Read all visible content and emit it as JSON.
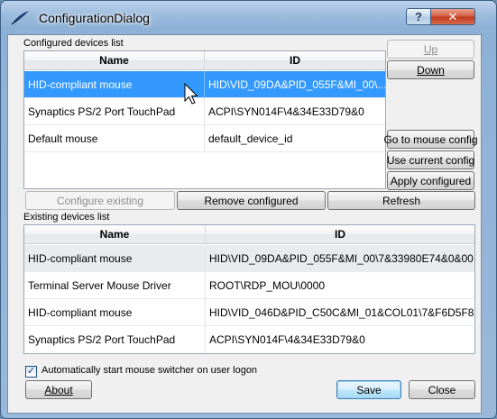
{
  "window": {
    "title": "ConfigurationDialog",
    "help_glyph": "?",
    "close_glyph": "✕"
  },
  "configured": {
    "group_label": "Configured devices list",
    "columns": [
      "Name",
      "ID"
    ],
    "rows": [
      {
        "name": "HID-compliant mouse",
        "id": "HID\\VID_09DA&PID_055F&MI_00\\..."
      },
      {
        "name": "Synaptics PS/2 Port TouchPad",
        "id": "ACPI\\SYN014F\\4&34E33D79&0"
      },
      {
        "name": "Default mouse",
        "id": "default_device_id"
      }
    ],
    "side_buttons": {
      "up": "Up",
      "down": "Down",
      "goto": "Go to mouse config",
      "use_current": "Use current config",
      "apply": "Apply configured"
    },
    "action_buttons": {
      "configure": "Configure existing",
      "remove": "Remove configured",
      "refresh": "Refresh"
    }
  },
  "existing": {
    "group_label": "Existing devices list",
    "columns": [
      "Name",
      "ID"
    ],
    "rows": [
      {
        "name": "HID-compliant mouse",
        "id": "HID\\VID_09DA&PID_055F&MI_00\\7&33980E74&0&00..."
      },
      {
        "name": "Terminal Server Mouse Driver",
        "id": "ROOT\\RDP_MOU\\0000"
      },
      {
        "name": "HID-compliant mouse",
        "id": "HID\\VID_046D&PID_C50C&MI_01&COL01\\7&F6D5F8..."
      },
      {
        "name": "Synaptics PS/2 Port TouchPad",
        "id": "ACPI\\SYN014F\\4&34E33D79&0"
      }
    ]
  },
  "autostart": {
    "label": "Automatically start mouse switcher on user logon",
    "checked": true,
    "check_glyph": "✓"
  },
  "footer": {
    "about": "About",
    "save": "Save",
    "close": "Close"
  },
  "colors": {
    "selection": "#3399ff",
    "title_bar": "#9fbedf",
    "close_button": "#c0381c"
  }
}
